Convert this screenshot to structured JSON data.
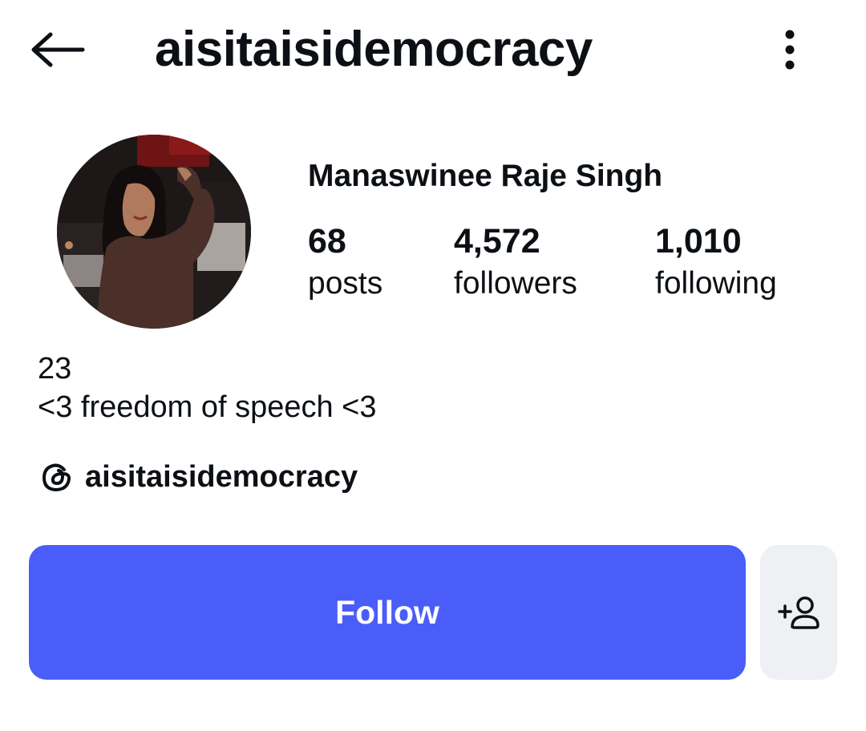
{
  "header": {
    "username": "aisitaisidemocracy",
    "back_icon": "arrow-left-icon",
    "more_icon": "vertical-ellipsis-icon"
  },
  "profile": {
    "display_name": "Manaswinee Raje Singh",
    "avatar_icon": "profile-photo"
  },
  "stats": {
    "posts": {
      "count": "68",
      "label": "posts"
    },
    "followers": {
      "count": "4,572",
      "label": "followers"
    },
    "following": {
      "count": "1,010",
      "label": "following"
    }
  },
  "bio": {
    "lines": [
      "23",
      "<3 freedom of speech <3"
    ]
  },
  "threads": {
    "icon": "threads-icon",
    "handle": "aisitaisidemocracy"
  },
  "actions": {
    "follow_label": "Follow",
    "suggest_icon": "add-person-icon"
  },
  "colors": {
    "accent": "#4a5df9",
    "secondary_button": "#eff0f4",
    "text": "#0c1014"
  }
}
